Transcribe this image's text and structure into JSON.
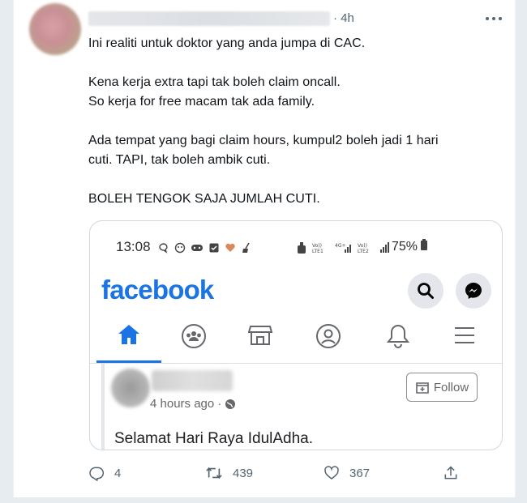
{
  "tweet": {
    "timestamp": "· 4h",
    "lines": [
      "Ini realiti untuk doktor yang anda jumpa di CAC.",
      "",
      "Kena kerja extra tapi tak boleh claim oncall.",
      "So kerja for free macam tak ada family.",
      "",
      "Ada tempat yang bagi claim hours, kumpul2 boleh jadi 1 hari",
      "cuti. TAPI, tak boleh ambik cuti.",
      "",
      "BOLEH TENGOK SAJA JUMLAH CUTI."
    ],
    "icons": {
      "more": "more-horizontal-icon"
    }
  },
  "embedded_screenshot": {
    "status_bar": {
      "time": "13:08",
      "battery": "75%"
    },
    "app_logo": "facebook",
    "post": {
      "time": "4 hours ago ·",
      "follow_label": "Follow",
      "text": "Selamat Hari Raya IdulAdha."
    },
    "nav_icons": [
      "home-icon",
      "groups-icon",
      "marketplace-icon",
      "profile-icon",
      "bell-icon",
      "menu-icon"
    ],
    "colors": {
      "brand": "#1b74e4"
    }
  },
  "actions": {
    "replies": "4",
    "retweets": "439",
    "likes": "367"
  }
}
